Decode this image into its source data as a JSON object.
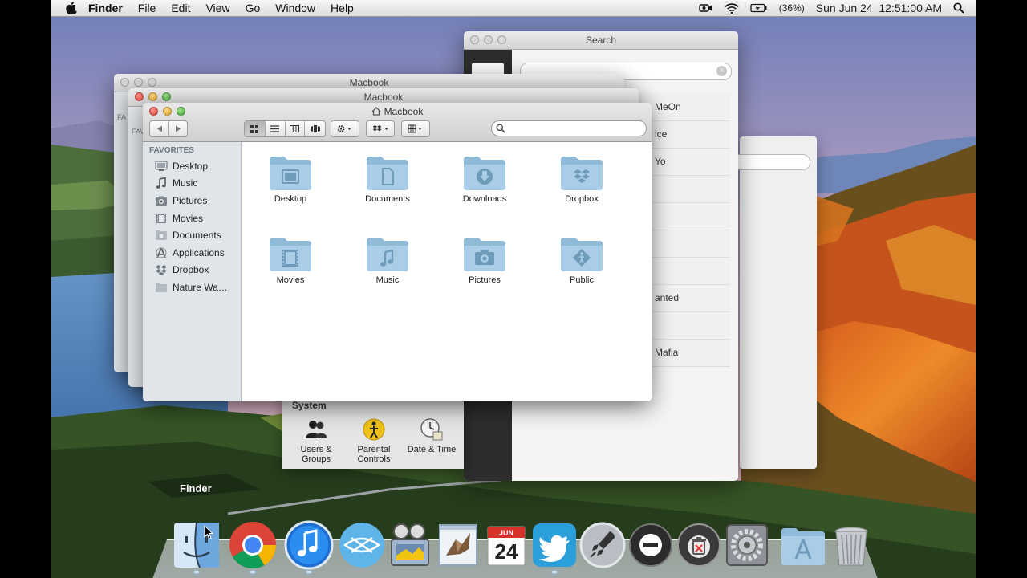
{
  "menubar": {
    "app_name": "Finder",
    "menus": [
      "File",
      "Edit",
      "View",
      "Go",
      "Window",
      "Help"
    ],
    "battery": "(36%)",
    "datetime": "Sun Jun 24  12:51:00 AM"
  },
  "search_window": {
    "title": "Search",
    "results": [
      "MeOn",
      "ice",
      "Yo",
      "",
      "",
      "",
      "",
      "anted",
      "",
      "Mafia"
    ]
  },
  "back_windows": {
    "title_back2": "Macbook",
    "title_back1": "Macbook",
    "sidebar_stub_back2": "FA",
    "sidebar_stub_back1": "FAVO"
  },
  "finder": {
    "title": "Macbook",
    "sidebar_header": "FAVORITES",
    "sidebar_items": [
      "Desktop",
      "Music",
      "Pictures",
      "Movies",
      "Documents",
      "Applications",
      "Dropbox",
      "Nature Wa…"
    ],
    "folders": [
      "Desktop",
      "Documents",
      "Downloads",
      "Dropbox",
      "Movies",
      "Music",
      "Pictures",
      "Public"
    ]
  },
  "system_prefs": {
    "section": "System",
    "item1_line1": "Users &",
    "item1_line2": "Groups",
    "item2_line1": "Parental",
    "item2_line2": "Controls",
    "item3_line1": "Date & Time"
  },
  "dock": {
    "tooltip": "Finder",
    "calendar_month": "JUN",
    "calendar_day": "24",
    "items": [
      "finder-icon",
      "chrome-icon",
      "itunes-icon",
      "xbmc-icon",
      "imovie-icon",
      "mail-icon",
      "ical-icon",
      "twitter-icon",
      "launchpad-icon",
      "dashboard-icon",
      "trash-app-icon",
      "system-preferences-icon",
      "applications-folder-icon",
      "trash-icon"
    ]
  },
  "colors": {
    "sidebar_bg": "#e0e5ea",
    "folder_blue": "#8fbbd8",
    "menubar_bg": "#e8e8e8"
  }
}
